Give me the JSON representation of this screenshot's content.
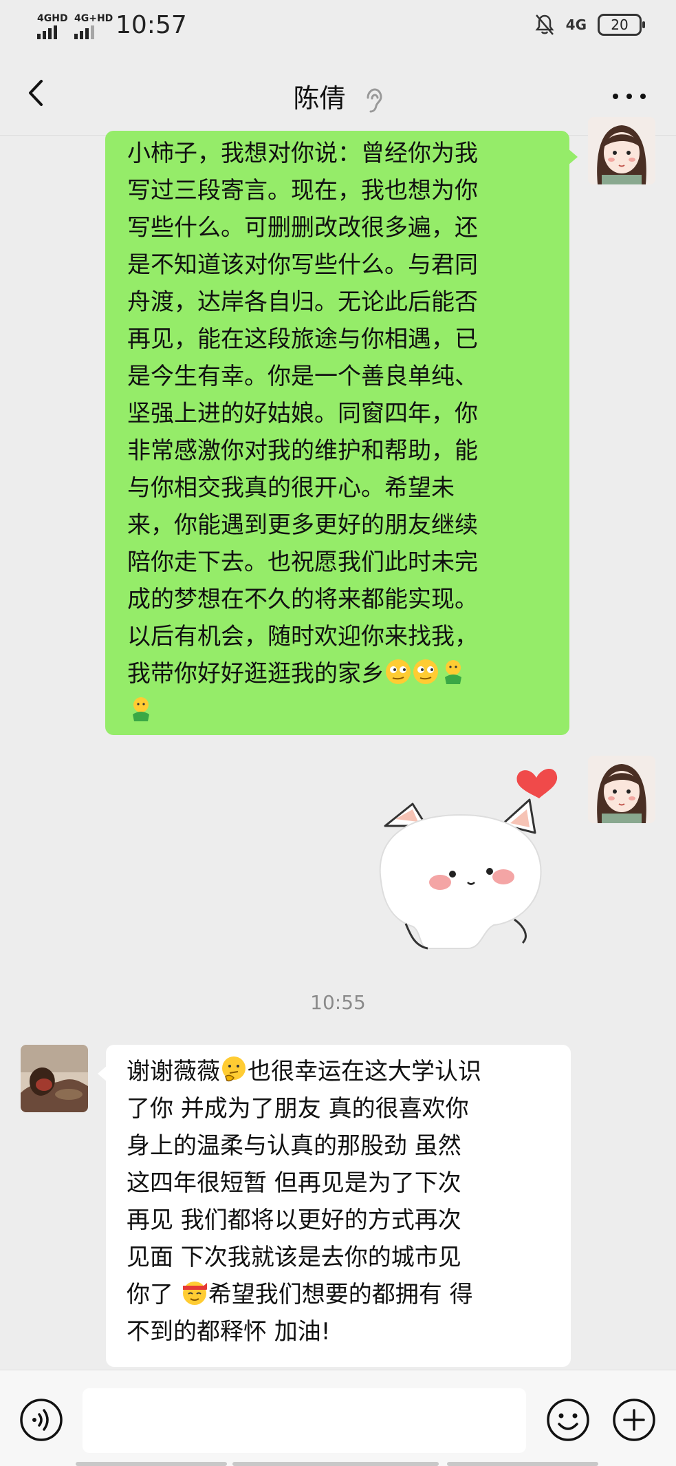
{
  "status_bar": {
    "signal1_label": "4GHD",
    "signal2_label": "4G+HD",
    "time": "10:57",
    "network": "4G",
    "battery": "20"
  },
  "header": {
    "title": "陈倩",
    "back_icon": "chevron-left-icon",
    "ear_icon": "ear-mode-icon",
    "more_icon": "more-dots-icon"
  },
  "messages": {
    "sent_text": "小柿子，我想对你说：曾经你为我\n写过三段寄言。现在，我也想为你\n写些什么。可删删改改很多遍，还\n是不知道该对你写些什么。与君同\n舟渡，达岸各自归。无论此后能否\n再见，能在这段旅途与你相遇，已\n是今生有幸。你是一个善良单纯、\n坚强上进的好姑娘。同窗四年，你\n非常感激你对我的维护和帮助，能\n与你相交我真的很开心。希望未\n来，你能遇到更多更好的朋友继续\n陪你走下去。也祝愿我们此时未完\n成的梦想在不久的将来都能实现。\n以后有机会，随时欢迎你来找我，\n我带你好好逛逛我的家乡",
    "timestamp": "10:55",
    "received_part1": "谢谢薇薇",
    "received_part2": "也很幸运在这大学认识\n了你 并成为了朋友 真的很喜欢你\n身上的温柔与认真的那股劲 虽然\n这四年很短暂 但再见是为了下次\n再见 我们都将以更好的方式再次\n见面 下次我就该是去你的城市见\n你了 ",
    "received_part3": "希望我们想要的都拥有 得\n不到的都释怀 加油!"
  },
  "input_bar": {
    "voice_icon": "voice-input-icon",
    "emoji_icon": "emoji-icon",
    "plus_icon": "plus-icon"
  },
  "colors": {
    "sent_bubble": "#95ec69",
    "received_bubble": "#ffffff",
    "background": "#ededed"
  }
}
